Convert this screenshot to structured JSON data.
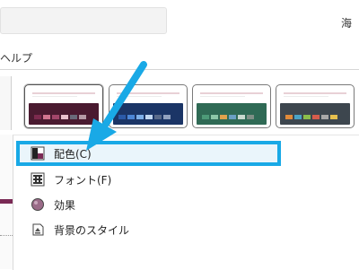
{
  "titlebar": {
    "right_text": "海"
  },
  "menubar": {
    "help_label": "ヘルプ"
  },
  "themes": [
    {
      "name": "theme-1",
      "band": "#4a1a30",
      "chips": [
        "#7c2a4e",
        "#d0758f",
        "#a2466a",
        "#e9c0cc",
        "#6a6a7a",
        "#b69aa6"
      ]
    },
    {
      "name": "theme-2",
      "band": "#1b3566",
      "chips": [
        "#2b5aa8",
        "#4c86d6",
        "#7fb0e8",
        "#c2d7ef",
        "#5a6b8a",
        "#92a2bf"
      ]
    },
    {
      "name": "theme-3",
      "band": "#2f6a55",
      "chips": [
        "#4d9a78",
        "#8cc7a8",
        "#e0a24c",
        "#6aa0c4",
        "#c9d9cf",
        "#7f8f86"
      ]
    },
    {
      "name": "theme-4",
      "band": "#3d464e",
      "chips": [
        "#e08a3a",
        "#4aa3c6",
        "#8bbd4a",
        "#d65c4c",
        "#a8a8a8",
        "#e6c04e"
      ]
    }
  ],
  "menu": {
    "items": [
      {
        "label": "配色(C)",
        "icon": "color-scheme-icon"
      },
      {
        "label": "フォント(F)",
        "icon": "font-icon"
      },
      {
        "label": "効果",
        "icon": "effects-icon"
      },
      {
        "label": "背景のスタイル",
        "icon": "background-style-icon"
      }
    ]
  },
  "colors": {
    "highlight_border": "#19a9e6",
    "arrow": "#19a9e6",
    "accent": "#7a2a55"
  }
}
